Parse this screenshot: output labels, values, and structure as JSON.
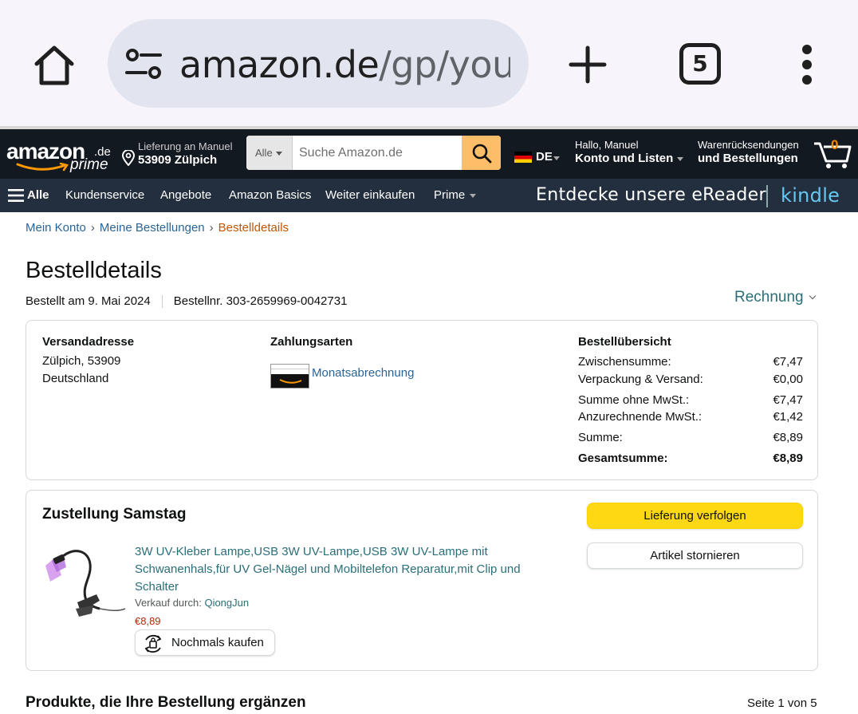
{
  "browser": {
    "url_host": "amazon.de",
    "url_path": "/gp/your-account/order-details",
    "tab_count": "5"
  },
  "nav": {
    "logo_word": "amazon",
    "logo_tld": ".de",
    "logo_prime": "prime",
    "deliver_line1": "Lieferung an Manuel",
    "deliver_line2": "53909 Zülpich",
    "search_category": "Alle",
    "search_placeholder": "Suche Amazon.de",
    "language": "DE",
    "account_line1": "Hallo, Manuel",
    "account_line2": "Konto und Listen",
    "orders_line1": "Warenrücksendungen",
    "orders_line2": "und Bestellungen",
    "cart_count": "0",
    "menu_all": "Alle",
    "links": [
      "Kundenservice",
      "Angebote",
      "Amazon Basics",
      "Weiter einkaufen",
      "Prime"
    ],
    "banner_text": "Entdecke unsere eReader",
    "banner_brand": "kindle"
  },
  "breadcrumb": {
    "account": "Mein Konto",
    "orders": "Meine Bestellungen",
    "current": "Bestelldetails"
  },
  "order": {
    "title": "Bestelldetails",
    "ordered_on": "Bestellt am 9. Mai 2024",
    "order_number": "Bestellnr. 303-2659969-0042731",
    "invoice_label": "Rechnung"
  },
  "shipping": {
    "heading": "Versandadresse",
    "line1": "Zülpich, 53909",
    "line2": "Deutschland"
  },
  "payment": {
    "heading": "Zahlungsarten",
    "method": "Monatsabrechnung"
  },
  "summary": {
    "heading": "Bestellübersicht",
    "rows": [
      {
        "label": "Zwischensumme:",
        "value": "€7,47"
      },
      {
        "label": "Verpackung & Versand:",
        "value": "€0,00"
      },
      {
        "label": "Summe ohne MwSt.:",
        "value": "€7,47"
      },
      {
        "label": "Anzurechnende MwSt.:",
        "value": "€1,42"
      },
      {
        "label": "Summe:",
        "value": "€8,89"
      },
      {
        "label": "Gesamtsumme:",
        "value": "€8,89"
      }
    ]
  },
  "delivery": {
    "heading": "Zustellung Samstag",
    "product_title": "3W UV-Kleber Lampe,USB 3W UV-Lampe,USB 3W UV-Lampe mit Schwanenhals,für UV Gel-Nägel und Mobiltelefon Reparatur,mit Clip und Schalter",
    "seller_prefix": "Verkauf durch: ",
    "seller_name": "QiongJun",
    "price": "€8,89",
    "buy_again": "Nochmals kaufen",
    "track_button": "Lieferung verfolgen",
    "cancel_button": "Artikel stornieren"
  },
  "recommendations": {
    "heading": "Produkte, die Ihre Bestellung ergänzen",
    "page_info": "Seite 1 von 5"
  }
}
